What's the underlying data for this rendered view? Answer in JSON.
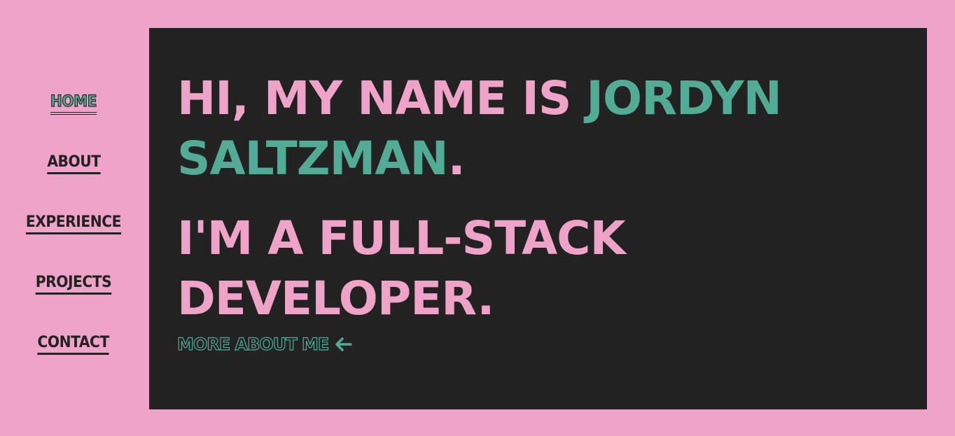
{
  "nav": {
    "items": [
      {
        "label": "HOME",
        "active": true
      },
      {
        "label": "ABOUT",
        "active": false
      },
      {
        "label": "EXPERIENCE",
        "active": false
      },
      {
        "label": "PROJECTS",
        "active": false
      },
      {
        "label": "CONTACT",
        "active": false
      }
    ]
  },
  "hero": {
    "greeting_prefix": "HI, MY NAME IS ",
    "name": "JORDYN SALTZMAN",
    "greeting_suffix": ".",
    "role_line": "I'M A FULL-STACK DEVELOPER.",
    "more_link": "MORE ABOUT ME",
    "more_link_icon": "arrow-left-icon"
  },
  "colors": {
    "background": "#f0a3c8",
    "panel": "#222222",
    "pink": "#f0a3c8",
    "green": "#52ab95",
    "dark": "#222222"
  }
}
